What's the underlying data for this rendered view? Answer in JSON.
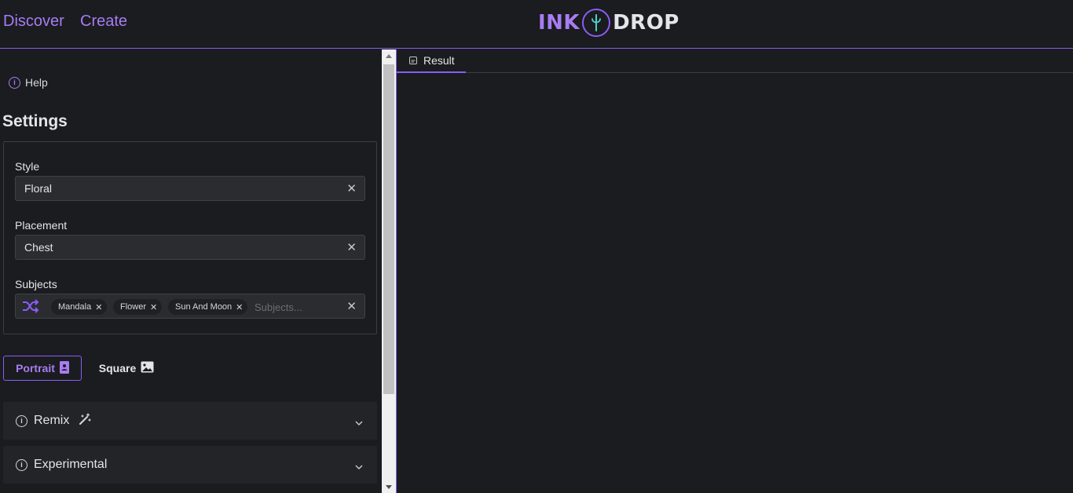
{
  "nav": {
    "discover": "Discover",
    "create": "Create"
  },
  "logo": {
    "left": "INK",
    "right": "DROP"
  },
  "help": {
    "label": "Help"
  },
  "settings": {
    "title": "Settings",
    "style": {
      "label": "Style",
      "value": "Floral"
    },
    "placement": {
      "label": "Placement",
      "value": "Chest"
    },
    "subjects": {
      "label": "Subjects",
      "chips": [
        "Mandala",
        "Flower",
        "Sun And Moon"
      ],
      "placeholder": "Subjects..."
    }
  },
  "aspect": {
    "portrait": "Portrait",
    "square": "Square",
    "selected": "Portrait"
  },
  "accordions": {
    "remix": "Remix",
    "experimental": "Experimental"
  },
  "result_tab": {
    "label": "Result"
  },
  "colors": {
    "accent": "#8b5cf6",
    "accent_text": "#a87cf2",
    "logo_mark": "#4fd1c5",
    "background": "#1a1c1f"
  },
  "icons": [
    "info-icon",
    "close-icon",
    "shuffle-icon",
    "portrait-icon",
    "image-icon",
    "magic-wand-icon",
    "chevron-down-icon",
    "result-tab-icon",
    "brush-icon"
  ]
}
